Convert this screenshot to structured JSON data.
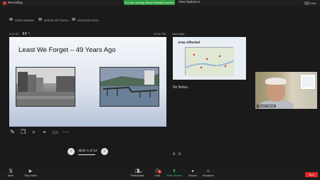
{
  "topbar": {
    "recording_label": "Recording",
    "share_banner": "You are viewing Stuart Saleski's screen",
    "view_options": "View Options ▾",
    "view_label": "View"
  },
  "presenter": {
    "tools": [
      "SHOW TASKBAR",
      "DISPLAY SETTINGS ▾",
      "END SLIDE SHOW"
    ],
    "timer": "0:01:25",
    "clock": "12:51 PM",
    "next_label": "Next slide"
  },
  "slide": {
    "title": "Least We Forget – 49 Years Ago"
  },
  "slide_nav": {
    "prev": "‹",
    "next": "›",
    "slide_text": "Slide 3 of 12"
  },
  "next_slide": {
    "title": "Area Affected"
  },
  "notes": {
    "text": "No Notes."
  },
  "video": {
    "name": "Stuart Saleski"
  },
  "controls": {
    "mute": "Mute",
    "stop_video": "Stop Video",
    "participants": "Participants",
    "participants_count": "29",
    "chat": "Chat",
    "chat_badge": "1",
    "share_screen": "Share Screen",
    "record": "Record",
    "reactions": "Reactions",
    "end": "End"
  },
  "colors": {
    "share_green": "#2e9d3f",
    "end_red": "#e02828"
  }
}
